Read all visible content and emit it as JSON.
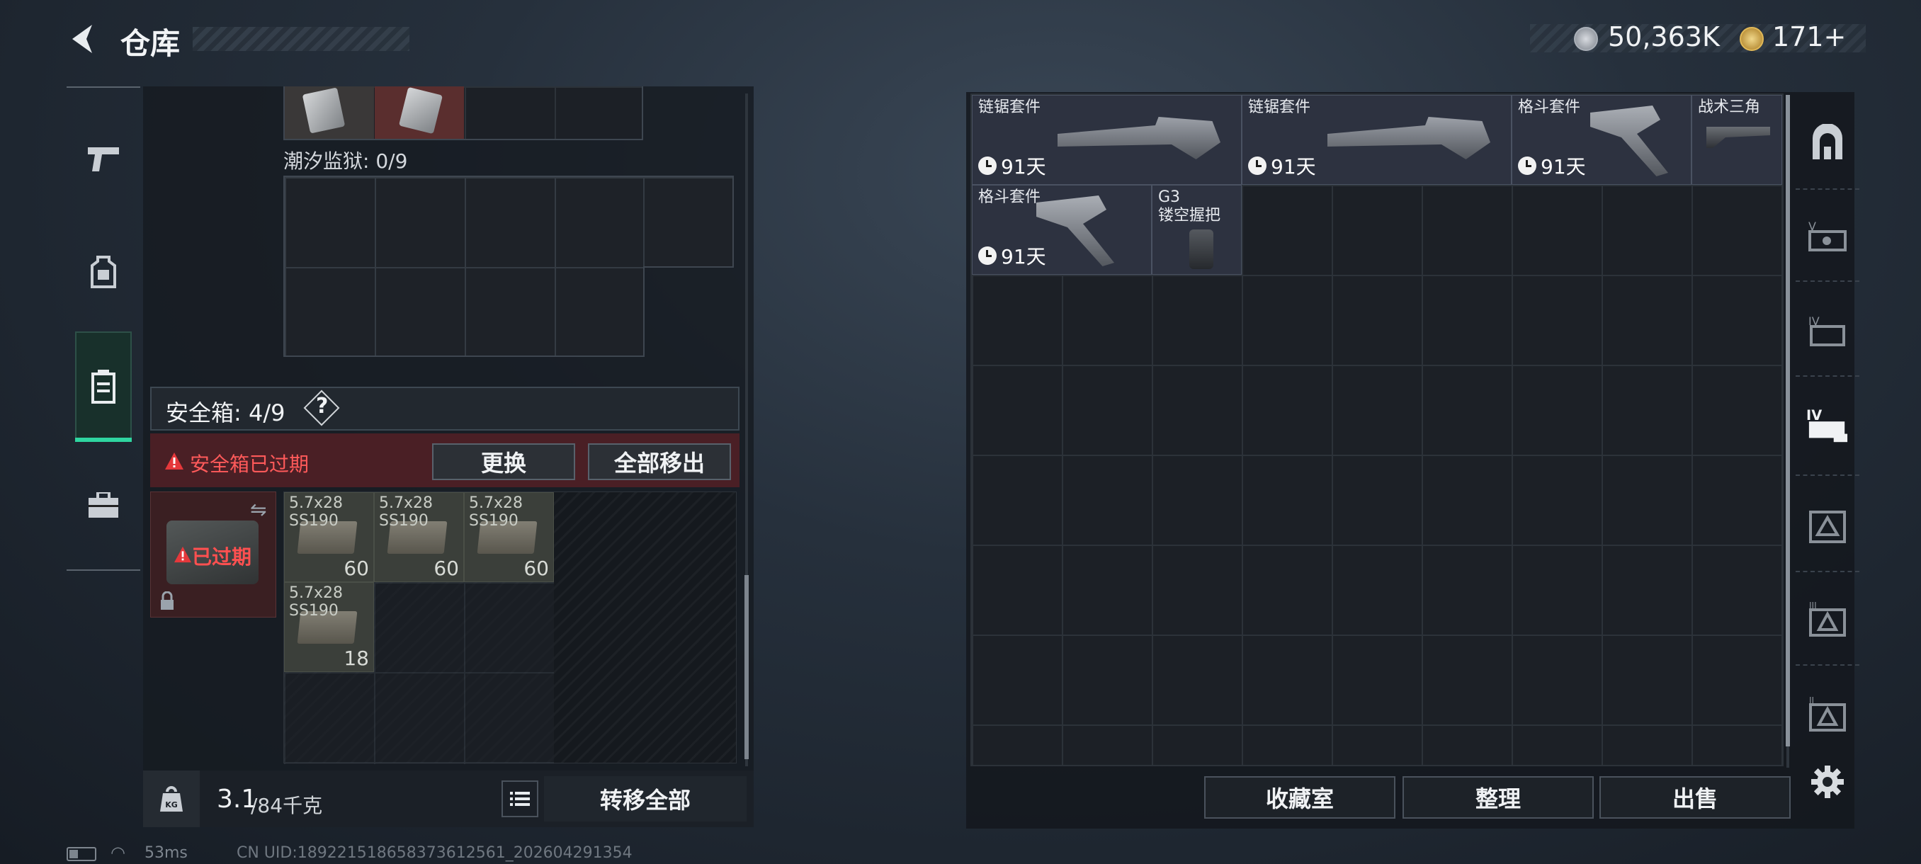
{
  "header": {
    "title": "仓库",
    "currency1": "50,363K",
    "currency2": "171+"
  },
  "left_tabs": [
    "weapon-tab",
    "armor-tab",
    "container-tab",
    "toolbox-tab"
  ],
  "stash": {
    "prison_label": "潮汐监狱: 0/9",
    "safebox_label": "安全箱: 4/9",
    "help": "?",
    "warning_text": "安全箱已过期",
    "replace_button": "更换",
    "move_all_out_button": "全部移出",
    "expired_badge": "已过期",
    "ammo": [
      {
        "name": "5.7x28",
        "sub": "SS190",
        "count": "60"
      },
      {
        "name": "5.7x28",
        "sub": "SS190",
        "count": "60"
      },
      {
        "name": "5.7x28",
        "sub": "SS190",
        "count": "60"
      },
      {
        "name": "5.7x28",
        "sub": "SS190",
        "count": "18"
      }
    ]
  },
  "footer_left": {
    "weight": "3.1",
    "weight_total": "/84千克",
    "transfer_all_button": "转移全部"
  },
  "right_grid": {
    "items": [
      {
        "name": "链锯套件",
        "timer": "91天"
      },
      {
        "name": "链锯套件",
        "timer": "91天"
      },
      {
        "name": "格斗套件",
        "timer": "91天"
      },
      {
        "name": "战术三角"
      },
      {
        "name": "格斗套件",
        "timer": "91天"
      },
      {
        "name": "G3",
        "name2": "镂空握把"
      }
    ]
  },
  "footer_right": {
    "collection_button": "收藏室",
    "sort_button": "整理",
    "sell_button": "出售"
  },
  "status": {
    "ping": "53ms",
    "uid": "CN UID:189221518658373612561_202604291354"
  },
  "accent_color": "#2fd5a0"
}
